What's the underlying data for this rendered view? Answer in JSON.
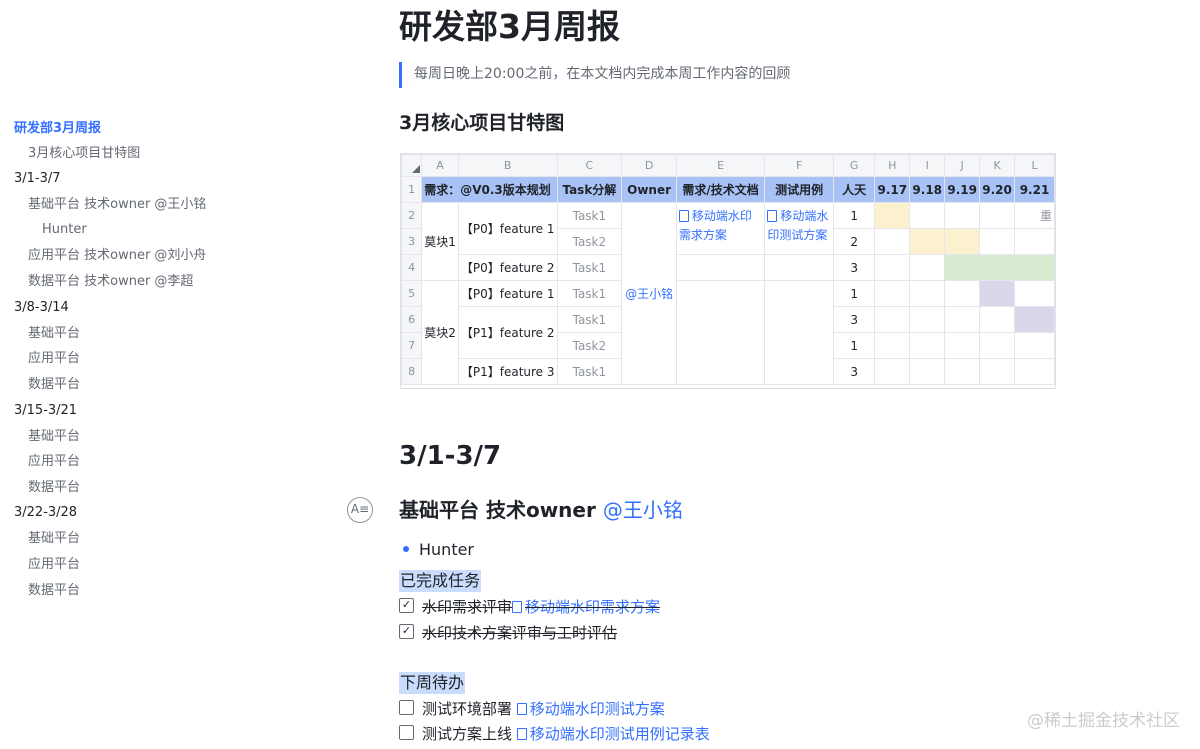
{
  "outline": [
    {
      "label": "研发部3月周报",
      "active": true
    },
    {
      "label": "3月核心项目甘特图"
    },
    {
      "label": "3/1-3/7"
    },
    {
      "label": "基础平台 技术owner @王小铭"
    },
    {
      "label": "Hunter"
    },
    {
      "label": "应用平台 技术owner @刘小舟"
    },
    {
      "label": "数据平台 技术owner @李超"
    },
    {
      "label": "3/8-3/14"
    },
    {
      "label": "基础平台"
    },
    {
      "label": "应用平台"
    },
    {
      "label": "数据平台"
    },
    {
      "label": "3/15-3/21"
    },
    {
      "label": "基础平台"
    },
    {
      "label": "应用平台"
    },
    {
      "label": "数据平台"
    },
    {
      "label": "3/22-3/28"
    },
    {
      "label": "基础平台"
    },
    {
      "label": "应用平台"
    },
    {
      "label": "数据平台"
    }
  ],
  "doc": {
    "title": "研发部3月周报",
    "quote": "每周日晚上20:00之前，在本文档内完成本周工作内容的回顾",
    "gantt_heading": "3月核心项目甘特图"
  },
  "sheet": {
    "col_letters": [
      "A",
      "B",
      "C",
      "D",
      "E",
      "F",
      "G",
      "H",
      "I",
      "J",
      "K",
      "L"
    ],
    "row_numbers": [
      "1",
      "2",
      "3",
      "4",
      "5",
      "6",
      "7",
      "8"
    ],
    "header": {
      "a": "需求：@V0.3版本规划",
      "task": "Task分解",
      "owner": "Owner",
      "doc": "需求/技术文档",
      "test": "测试用例",
      "days": "人天",
      "dates": [
        "9.17",
        "9.18",
        "9.19",
        "9.20",
        "9.21"
      ]
    },
    "module1": "莫块1",
    "module2": "莫块2",
    "features": [
      "【P0】feature 1",
      "【P0】feature 2",
      "【P0】feature 1",
      "【P1】feature 2",
      "【P1】feature 3"
    ],
    "tasks": [
      "Task1",
      "Task2",
      "Task1",
      "Task1",
      "Task1",
      "Task2",
      "Task1"
    ],
    "owner": "@王小铭",
    "req_doc": "移动端水印需求方案",
    "test_doc": "移动端水印测试方案",
    "days": [
      "1",
      "2",
      "3",
      "1",
      "3",
      "1",
      "3"
    ],
    "overflow_char": "重",
    "bar_colors": {
      "yellow": "#fbf1cf",
      "green": "#d8ead0",
      "purple": "#dcd6ea"
    }
  },
  "section": {
    "heading": "3/1-3/7",
    "h3_text": "基础平台  技术owner",
    "h3_mention": "@王小铭",
    "h3_icon": "A≡",
    "bullet": "Hunter",
    "done_label": "已完成任务",
    "done_items": [
      {
        "text": "水印需求评审",
        "link": "移动端水印需求方案"
      },
      {
        "text": "水印技术方案评审与工时评估",
        "link": ""
      }
    ],
    "next_label": "下周待办",
    "next_items": [
      {
        "text": "测试环境部署",
        "link": "移动端水印测试方案"
      },
      {
        "text": "测试方案上线",
        "link": "移动端水印测试用例记录表"
      }
    ]
  },
  "watermark": "@稀土掘金技术社区"
}
